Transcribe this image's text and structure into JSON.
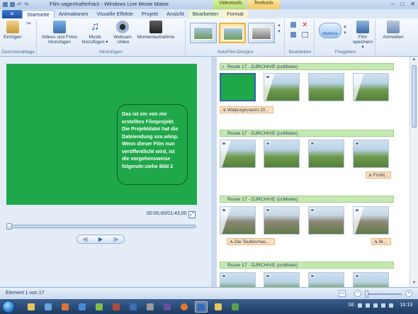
{
  "window": {
    "title": "Film sagenhafterharz - Windows Live Movie Maker",
    "context_tabs": {
      "video": "Videotools",
      "text": "Texttools"
    },
    "controls": {
      "minimize": "–",
      "maximize": "□",
      "close": "✕"
    }
  },
  "ribbon": {
    "menu_icon": "≡",
    "tabs": [
      "Startseite",
      "Animationen",
      "Visuelle Effekte",
      "Projekt",
      "Ansicht",
      "Bearbeiten",
      "Format"
    ],
    "active_tab": "Startseite",
    "groups": {
      "clipboard": {
        "label": "Zwischenablage",
        "paste": "Einfügen",
        "cut_icon": "✂"
      },
      "add": {
        "label": "Hinzufügen",
        "add_videos": [
          "Videos und Fotos",
          "hinzufügen"
        ],
        "music": [
          "Musik",
          "hinzufügen ▾"
        ],
        "webcam": [
          "Webcam",
          "-Video"
        ],
        "snapshot": "Momentaufnahme"
      },
      "themes": {
        "label": "AutoFilm-Designs"
      },
      "edit": {
        "label": "Bearbeiten"
      },
      "share": {
        "label": "Freigeben",
        "skydrive": "SkyDrive",
        "save_movie": [
          "Film",
          "speichern ▾"
        ]
      },
      "signin": {
        "label": "Anmelden"
      }
    },
    "icons": {
      "undo": "↶",
      "redo": "↷",
      "scroll_up": "▲",
      "scroll_down": "▼"
    }
  },
  "preview": {
    "overlay_text": "Das ist ein von mir erstelltes Filmprojekt. Die Projektdatei hat die Dateiendung xxx.wlmp. Wenn dieser Film nun veröffentlicht wird, ist die vorgehensweise folgende:siehe Bild 2",
    "timecode": "00:00,00/01:43,00",
    "fullscreen_icon": "⤢",
    "transport": {
      "prev": "◀|",
      "play": "▶",
      "next": "|▶"
    }
  },
  "storyboard": {
    "music_label": "Route 17  - DJRCHIVE (ccMixter)",
    "music_label_short": "Route 17  - DJRCHIVE (ccMixter)",
    "music_note_icon": "♪",
    "caption_icon": "A",
    "captions": [
      "Walpurgisnacht 20...",
      "Frühli...",
      "Die Teufelsmau...",
      "Bl..."
    ]
  },
  "status": {
    "element_text": "Element 1 von 17",
    "zoom_out": "−",
    "zoom_in": "+",
    "monitor_icon": "▭"
  },
  "taskbar": {
    "language": "DE",
    "clock": "16:13"
  },
  "colors": {
    "preview_green": "#1fa84a",
    "music_bar": "#c6e8b3",
    "caption_bg": "#fde0bd",
    "ribbon_bg": "#dbe7f6"
  }
}
